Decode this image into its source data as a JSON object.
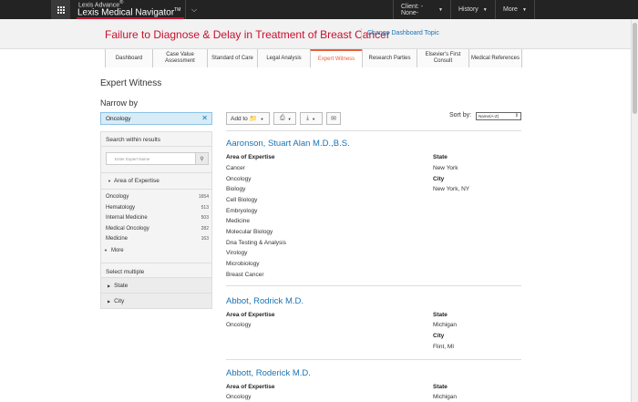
{
  "topbar": {
    "brand_super": "Lexis Advance",
    "brand_reg": "®",
    "brand_main": "Lexis Medical Navigator",
    "brand_tm": "TM",
    "client_label": "Client: -None-",
    "history_label": "History",
    "more_label": "More"
  },
  "dashboard": {
    "title": "Failure to Diagnose & Delay in Treatment of Breast Cancer",
    "change_topic": "Change Dashboard Topic"
  },
  "tabs": [
    {
      "label": "Dashboard",
      "active": false
    },
    {
      "label": "Case Value Assessment",
      "active": false
    },
    {
      "label": "Standard of Care",
      "active": false
    },
    {
      "label": "Legal Analysis",
      "active": false
    },
    {
      "label": "Expert Witness",
      "active": true
    },
    {
      "label": "Research Parties",
      "active": false
    },
    {
      "label": "Elsevier's First Consult",
      "active": false
    },
    {
      "label": "Medical References",
      "active": false
    }
  ],
  "page": {
    "title": "Expert Witness",
    "narrow_by": "Narrow by"
  },
  "filter": {
    "chip_value": "Oncology"
  },
  "sidepanel": {
    "search_within": "Search within results",
    "search_placeholder": "Enter Expert Name",
    "aoe_heading": "Area of Expertise",
    "aoe_items": [
      {
        "label": "Oncology",
        "count": "1654"
      },
      {
        "label": "Hematology",
        "count": "513"
      },
      {
        "label": "Internal Medicine",
        "count": "503"
      },
      {
        "label": "Medical Oncology",
        "count": "282"
      },
      {
        "label": "Medicine",
        "count": "163"
      }
    ],
    "more": "More",
    "select_multiple": "Select multiple",
    "state": "State",
    "city": "City"
  },
  "toolbar": {
    "add_to": "Add to",
    "sort_by": "Sort by:",
    "sort_value": "Name(A-Z)"
  },
  "results": [
    {
      "name": "Aaronson, Stuart Alan M.D.,B.S.",
      "area_label": "Area of Expertise",
      "areas": [
        "Cancer",
        "Oncology",
        "Biology",
        "Cell Biology",
        "Embryology",
        "Medicine",
        "Molecular Biology",
        "Dna Testing & Analysis",
        "Virology",
        "Microbiology",
        "Breast Cancer"
      ],
      "state_label": "State",
      "state": "New York",
      "city_label": "City",
      "city": "New York, NY"
    },
    {
      "name": "Abbot, Rodrick M.D.",
      "area_label": "Area of Expertise",
      "areas": [
        "Oncology"
      ],
      "state_label": "State",
      "state": "Michigan",
      "city_label": "City",
      "city": "Flint, MI"
    },
    {
      "name": "Abbott, Roderick M.D.",
      "area_label": "Area of Expertise",
      "areas": [
        "Oncology"
      ],
      "state_label": "State",
      "state": "Michigan"
    }
  ]
}
